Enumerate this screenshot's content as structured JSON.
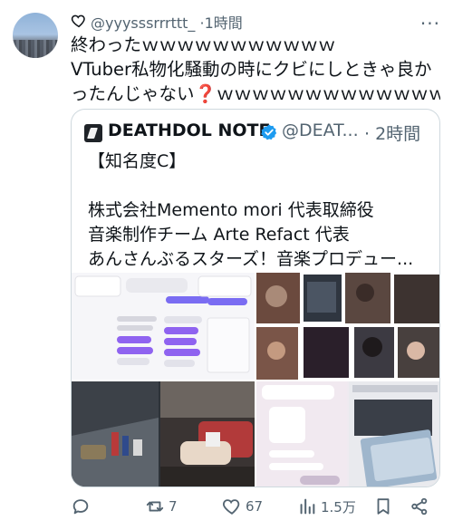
{
  "tweet": {
    "handle": "@yyysssrrrttt_",
    "time_sep": "·",
    "time": "1時間",
    "text_line1": "終わったｗｗｗｗｗｗｗｗｗｗｗ",
    "text_line2": "VTuber私物化騒動の時にクビにしときゃ良か",
    "text_line3_a": "ったんじゃない",
    "text_line3_q": "❓",
    "text_line3_b": "ｗｗｗｗｗｗｗｗｗｗｗｗｗ",
    "more_label": "···"
  },
  "quote": {
    "name": "DEATHDOL NOTE",
    "handle": "@DEAT...",
    "time": "· 2時間",
    "lines": [
      "【知名度C】",
      "",
      "株式会社Memento mori 代表取締役",
      "音楽制作チーム Arte Refact 代表",
      "あんさんぶるスターズ！音楽プロデュー..."
    ]
  },
  "actions": {
    "reply_count": "",
    "retweet_count": "7",
    "like_count": "67",
    "views_count": "1.5万"
  },
  "colors": {
    "text": "#0f1419",
    "muted": "#536471",
    "border": "#cfd9de",
    "verified": "#1d9bf0"
  }
}
